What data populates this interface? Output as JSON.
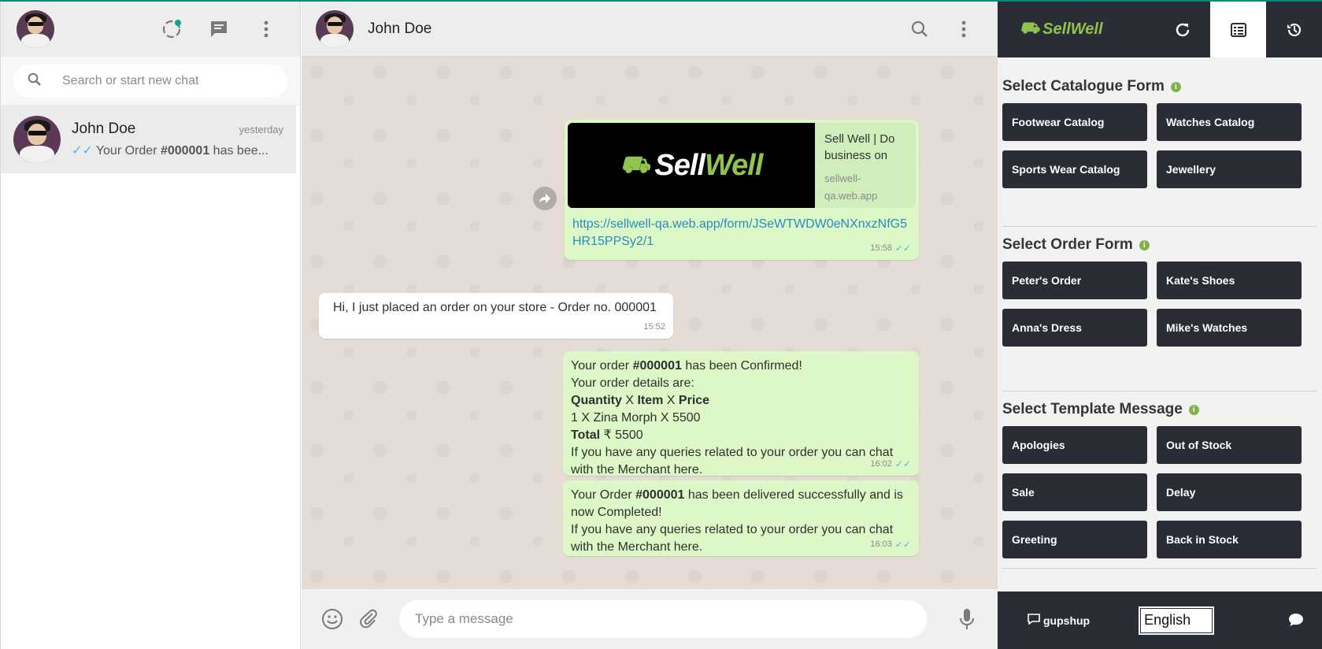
{
  "left": {
    "search_placeholder": "Search or start new chat",
    "chats": [
      {
        "name": "John Doe",
        "time": "yesterday",
        "last_prefix": "Your Order ",
        "last_bold": "#000001",
        "last_suffix": " has bee..."
      }
    ]
  },
  "conversation": {
    "contact_name": "John Doe",
    "messages": {
      "link_msg": {
        "preview_title": "Sell Well | Do business on",
        "preview_domain": "sellwell-qa.web.app",
        "preview_logo_a": "Sell",
        "preview_logo_b": "Well",
        "url": "https://sellwell-qa.web.app/form/JSeWTWDW0eNXnxzNfG5HR15PPSy2/1",
        "time": "15:58"
      },
      "incoming": {
        "text": "Hi, I just placed an order on your store - Order no. 000001",
        "time": "15:52"
      },
      "confirm": {
        "l1_a": "Your order ",
        "l1_b": "#000001",
        "l1_c": " has been Confirmed!",
        "l2": "Your order details are:",
        "l3_q": "Quantity",
        "l3_x1": " X ",
        "l3_i": "Item",
        "l3_x2": " X ",
        "l3_p": "Price",
        "l4": "1 X Zina Morph X 5500",
        "l5_a": "Total",
        "l5_b": " ₹ 5500",
        "l6": " If you have any queries related to your order you can chat with the Merchant here.",
        "time": "16:02"
      },
      "delivered": {
        "l1_a": "Your Order ",
        "l1_b": "#000001",
        "l1_c": " has been delivered successfully and is now Completed!",
        "l2": " If you have any queries related to your order you can chat with the Merchant here.",
        "time": "16:03"
      }
    },
    "composer_placeholder": "Type a message"
  },
  "sidebar": {
    "brand": "SellWell",
    "sections": [
      {
        "title": "Select Catalogue Form",
        "buttons": [
          "Footwear Catalog",
          "Watches Catalog",
          "Sports Wear Catalog",
          "Jewellery"
        ]
      },
      {
        "title": "Select Order Form",
        "buttons": [
          "Peter's Order",
          "Kate's Shoes",
          "Anna's Dress",
          "Mike's Watches"
        ]
      },
      {
        "title": "Select Template Message",
        "buttons": [
          "Apologies",
          "Out of Stock",
          "Sale",
          "Delay",
          "Greeting",
          "Back in Stock"
        ]
      }
    ],
    "footer": {
      "brand": "gupshup",
      "language": "English"
    }
  },
  "colors": {
    "accent": "#0a8a7a",
    "dark_panel": "#2b2d36",
    "out_bubble": "#dcf8c6",
    "brand_green": "#8fc44e",
    "tick_blue": "#4fb6ec"
  }
}
